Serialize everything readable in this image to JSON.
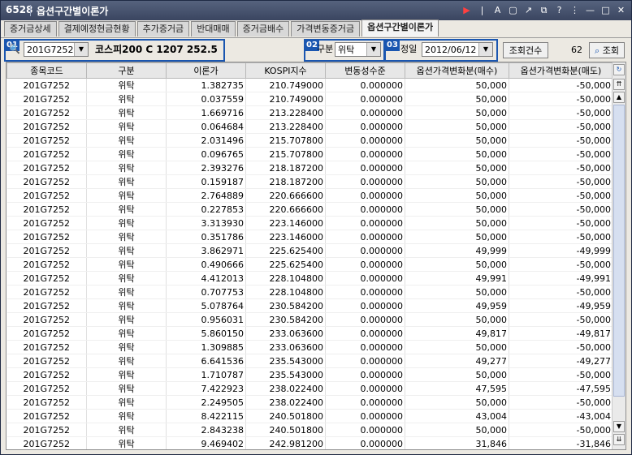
{
  "window": {
    "code": "6528",
    "title": "옵션구간별이론가"
  },
  "tabs": [
    "증거금상세",
    "결제예정현금현황",
    "추가증거금",
    "반대매매",
    "증거금배수",
    "가격변동증거금",
    "옵션구간별이론가"
  ],
  "toolbar": {
    "badge1": "01",
    "code_value": "201G7252",
    "instrument": "코스피200 C 1207 252.5",
    "badge2": "02",
    "gubun_label": "구분",
    "gubun_value": "위탁",
    "badge3": "03",
    "date_label": "정일",
    "date_value": "2012/06/12",
    "count_label": "조회건수",
    "count_value": "62",
    "search_label": "조회"
  },
  "columns": [
    "종목코드",
    "구분",
    "이론가",
    "KOSPI지수",
    "변동성수준",
    "옵션가격변화분(매수)",
    "옵션가격변화분(매도)"
  ],
  "rows": [
    [
      "201G7252",
      "위탁",
      "1.382735",
      "210.749000",
      "0.000000",
      "50,000",
      "-50,000"
    ],
    [
      "201G7252",
      "위탁",
      "0.037559",
      "210.749000",
      "0.000000",
      "50,000",
      "-50,000"
    ],
    [
      "201G7252",
      "위탁",
      "1.669716",
      "213.228400",
      "0.000000",
      "50,000",
      "-50,000"
    ],
    [
      "201G7252",
      "위탁",
      "0.064684",
      "213.228400",
      "0.000000",
      "50,000",
      "-50,000"
    ],
    [
      "201G7252",
      "위탁",
      "2.031496",
      "215.707800",
      "0.000000",
      "50,000",
      "-50,000"
    ],
    [
      "201G7252",
      "위탁",
      "0.096765",
      "215.707800",
      "0.000000",
      "50,000",
      "-50,000"
    ],
    [
      "201G7252",
      "위탁",
      "2.393276",
      "218.187200",
      "0.000000",
      "50,000",
      "-50,000"
    ],
    [
      "201G7252",
      "위탁",
      "0.159187",
      "218.187200",
      "0.000000",
      "50,000",
      "-50,000"
    ],
    [
      "201G7252",
      "위탁",
      "2.764889",
      "220.666600",
      "0.000000",
      "50,000",
      "-50,000"
    ],
    [
      "201G7252",
      "위탁",
      "0.227853",
      "220.666600",
      "0.000000",
      "50,000",
      "-50,000"
    ],
    [
      "201G7252",
      "위탁",
      "3.313930",
      "223.146000",
      "0.000000",
      "50,000",
      "-50,000"
    ],
    [
      "201G7252",
      "위탁",
      "0.351786",
      "223.146000",
      "0.000000",
      "50,000",
      "-50,000"
    ],
    [
      "201G7252",
      "위탁",
      "3.862971",
      "225.625400",
      "0.000000",
      "49,999",
      "-49,999"
    ],
    [
      "201G7252",
      "위탁",
      "0.490666",
      "225.625400",
      "0.000000",
      "50,000",
      "-50,000"
    ],
    [
      "201G7252",
      "위탁",
      "4.412013",
      "228.104800",
      "0.000000",
      "49,991",
      "-49,991"
    ],
    [
      "201G7252",
      "위탁",
      "0.707753",
      "228.104800",
      "0.000000",
      "50,000",
      "-50,000"
    ],
    [
      "201G7252",
      "위탁",
      "5.078764",
      "230.584200",
      "0.000000",
      "49,959",
      "-49,959"
    ],
    [
      "201G7252",
      "위탁",
      "0.956031",
      "230.584200",
      "0.000000",
      "50,000",
      "-50,000"
    ],
    [
      "201G7252",
      "위탁",
      "5.860150",
      "233.063600",
      "0.000000",
      "49,817",
      "-49,817"
    ],
    [
      "201G7252",
      "위탁",
      "1.309885",
      "233.063600",
      "0.000000",
      "50,000",
      "-50,000"
    ],
    [
      "201G7252",
      "위탁",
      "6.641536",
      "235.543000",
      "0.000000",
      "49,277",
      "-49,277"
    ],
    [
      "201G7252",
      "위탁",
      "1.710787",
      "235.543000",
      "0.000000",
      "50,000",
      "-50,000"
    ],
    [
      "201G7252",
      "위탁",
      "7.422923",
      "238.022400",
      "0.000000",
      "47,595",
      "-47,595"
    ],
    [
      "201G7252",
      "위탁",
      "2.249505",
      "238.022400",
      "0.000000",
      "50,000",
      "-50,000"
    ],
    [
      "201G7252",
      "위탁",
      "8.422115",
      "240.501800",
      "0.000000",
      "43,004",
      "-43,004"
    ],
    [
      "201G7252",
      "위탁",
      "2.843238",
      "240.501800",
      "0.000000",
      "50,000",
      "-50,000"
    ],
    [
      "201G7252",
      "위탁",
      "9.469402",
      "242.981200",
      "0.000000",
      "31,846",
      "-31,846"
    ]
  ]
}
